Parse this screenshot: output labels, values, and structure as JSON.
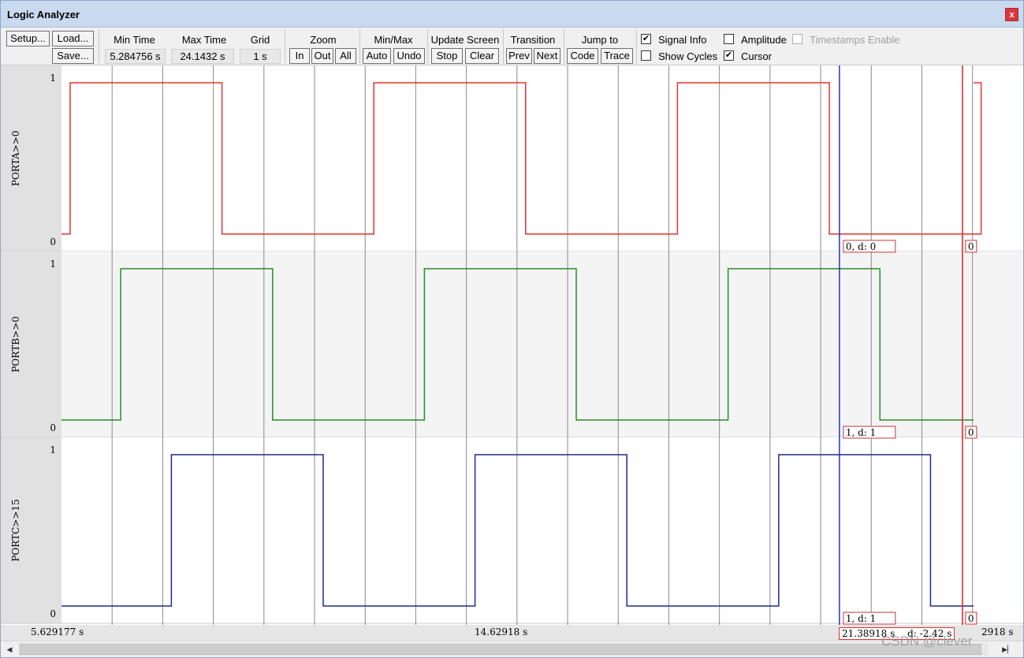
{
  "window": {
    "title": "Logic Analyzer",
    "close_glyph": "x"
  },
  "toolbar": {
    "setup_label": "Setup...",
    "load_label": "Load...",
    "save_label": "Save...",
    "min_time_label": "Min Time",
    "min_time_value": "5.284756 s",
    "max_time_label": "Max Time",
    "max_time_value": "24.1432 s",
    "grid_label": "Grid",
    "grid_value": "1 s",
    "zoom_label": "Zoom",
    "zoom_in": "In",
    "zoom_out": "Out",
    "zoom_all": "All",
    "minmax_label": "Min/Max",
    "minmax_auto": "Auto",
    "minmax_undo": "Undo",
    "update_label": "Update Screen",
    "update_stop": "Stop",
    "update_clear": "Clear",
    "transition_label": "Transition",
    "transition_prev": "Prev",
    "transition_next": "Next",
    "jump_label": "Jump to",
    "jump_code": "Code",
    "jump_trace": "Trace",
    "signal_info": {
      "label": "Signal Info",
      "checked": true
    },
    "amplitude": {
      "label": "Amplitude",
      "checked": false
    },
    "timestamps": {
      "label": "Timestamps Enable",
      "checked": false,
      "disabled": true
    },
    "show_cycles": {
      "label": "Show Cycles",
      "checked": false
    },
    "cursor": {
      "label": "Cursor",
      "checked": true
    }
  },
  "signals": [
    {
      "name": "PORTA>>0",
      "color": "#e8322d",
      "hi_label": "1",
      "lo_label": "0",
      "transitions": [
        [
          5.629177,
          0
        ],
        [
          5.8,
          1
        ],
        [
          8.8,
          0
        ],
        [
          11.8,
          1
        ],
        [
          14.8,
          0
        ],
        [
          17.8,
          1
        ],
        [
          20.8,
          0
        ],
        [
          23.8,
          1
        ]
      ],
      "info_a": "0,  d: 0",
      "info_b": "0"
    },
    {
      "name": "PORTB>>0",
      "color": "#2a8a2a",
      "hi_label": "1",
      "lo_label": "0",
      "transitions": [
        [
          5.629177,
          0
        ],
        [
          6.8,
          1
        ],
        [
          9.8,
          0
        ],
        [
          12.8,
          1
        ],
        [
          15.8,
          0
        ],
        [
          18.8,
          1
        ],
        [
          21.8,
          0
        ]
      ],
      "info_a": "1,  d: 1",
      "info_b": "0"
    },
    {
      "name": "PORTC>>15",
      "color": "#1f2a8c",
      "hi_label": "1",
      "lo_label": "0",
      "transitions": [
        [
          5.629177,
          0
        ],
        [
          7.8,
          1
        ],
        [
          10.8,
          0
        ],
        [
          13.8,
          1
        ],
        [
          16.8,
          0
        ],
        [
          19.8,
          1
        ],
        [
          22.8,
          0
        ]
      ],
      "info_a": "1,  d: 1",
      "info_b": "0"
    }
  ],
  "view": {
    "t_start": 5.629177,
    "t_end": 23.65,
    "grid_times": [
      6.629177,
      7.629177,
      8.629177,
      9.629177,
      10.629177,
      11.629177,
      12.629177,
      13.629177,
      14.629177,
      15.629177,
      16.629177,
      17.629177,
      18.629177,
      19.629177,
      20.629177,
      21.629177,
      22.629177,
      23.629177
    ]
  },
  "cursors": {
    "blue_time": 21.0,
    "red_time": 23.43,
    "blue_color": "#2233cc",
    "red_color": "#dd2222"
  },
  "status": {
    "left_time": "5.629177 s",
    "center_time": "14.62918 s",
    "cursor_time": "21.38918 s",
    "delta": "d: -2.42 s",
    "right_time": "2918 s"
  },
  "watermark": "CSDN @clever"
}
